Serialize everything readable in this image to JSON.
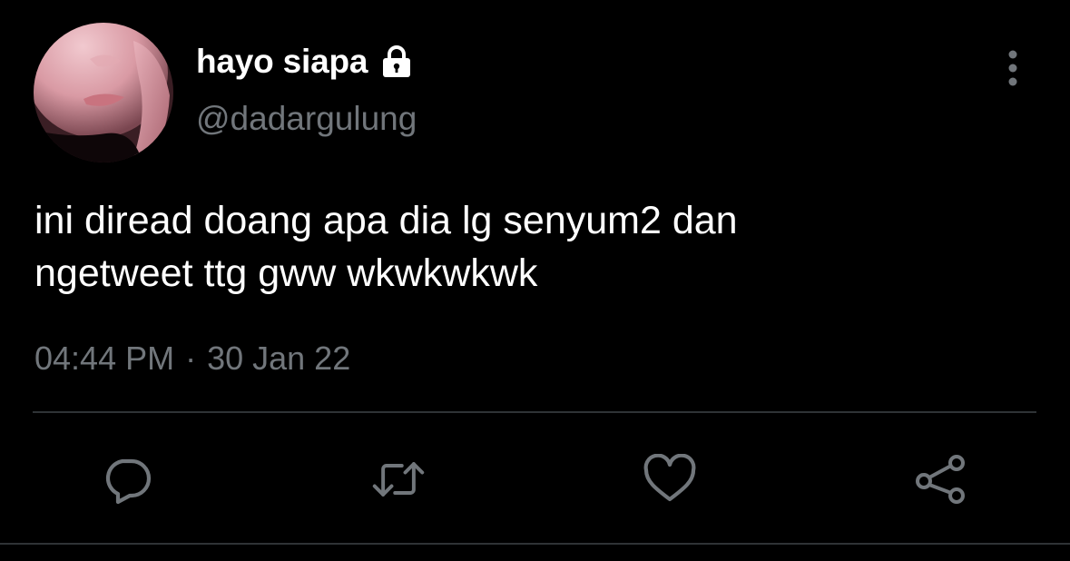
{
  "user": {
    "display_name": "hayo siapa",
    "handle": "@dadargulung",
    "avatar_icon": "avatar",
    "protected_icon": "lock-icon"
  },
  "tweet": {
    "text": "ini diread doang apa dia lg senyum2 dan\nngetweet ttg gww wkwkwkwk",
    "time": "04:44 PM",
    "separator": "·",
    "date": "30 Jan 22"
  },
  "actions": [
    {
      "name": "reply",
      "icon": "reply-icon"
    },
    {
      "name": "retweet",
      "icon": "retweet-icon"
    },
    {
      "name": "like",
      "icon": "heart-icon"
    },
    {
      "name": "share",
      "icon": "share-icon"
    }
  ],
  "menu": {
    "icon": "more-vertical-icon"
  },
  "colors": {
    "background": "#000000",
    "primary_text": "#ffffff",
    "secondary_text": "#71767b",
    "divider": "#2f3336"
  }
}
